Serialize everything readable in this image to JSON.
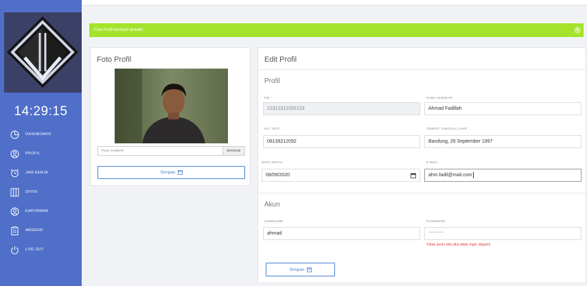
{
  "sidebar": {
    "clock": "14:29:15",
    "items": [
      {
        "label": "DASHBOARD",
        "icon": "pie-chart-icon"
      },
      {
        "label": "PROFIL",
        "icon": "user-icon"
      },
      {
        "label": "JAM KERJA",
        "icon": "alarm-icon"
      },
      {
        "label": "DIVISI",
        "icon": "columns-icon"
      },
      {
        "label": "KARYAWAN",
        "icon": "users-icon"
      },
      {
        "label": "ABSENSI",
        "icon": "clipboard-icon"
      },
      {
        "label": "LOG OUT",
        "icon": "power-icon"
      }
    ]
  },
  "alert": {
    "message": "Foto Profil berhasil diubah!",
    "close": "×",
    "color": "#a4e32a"
  },
  "photo_card": {
    "title": "Foto Profil",
    "file_placeholder": "PILIH GAMBAR",
    "browse_label": "BROWSE",
    "save_label": "Simpan"
  },
  "edit_card": {
    "title": "Edit Profil",
    "profil_section": "Profil",
    "nik_label": "NIK :",
    "nik_value": "12312312332123",
    "nama_label": "NAMA LENGKAP :",
    "nama_value": "Ahmad Fadillah",
    "telp_label": "NO. TELP :",
    "telp_value": "08139212092",
    "ttl_label": "TEMPAT, TANGGAL LAHIR :",
    "ttl_value": "Bandung, 26 September 1997",
    "masa_label": "MASA KERJA :",
    "masa_value": "08/09/2020",
    "email_label": "E-MAIL :",
    "email_value": "ahm.fadil@mail.com",
    "akun_section": "Akun",
    "username_label": "USERNAME",
    "username_value": "ahmad",
    "password_label": "PASSWORD",
    "password_placeholder": "********",
    "password_hint": "Tidak perlu diisi jika tidak ingin diganti!",
    "save_label": "Simpan"
  },
  "colors": {
    "sidebar": "#4f6fc9",
    "accent": "#4a7fd6",
    "error": "#e53b3b"
  }
}
